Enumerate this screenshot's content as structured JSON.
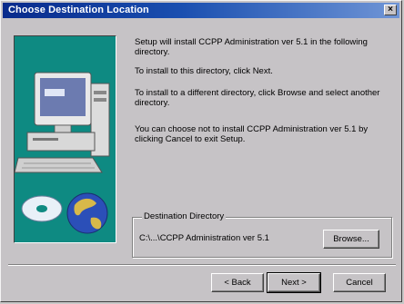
{
  "window": {
    "title": "Choose Destination Location"
  },
  "content": {
    "paragraph1": "Setup will install CCPP Administration ver 5.1 in the following directory.",
    "paragraph2": "To install to this directory, click Next.",
    "paragraph3": "To install to a different directory, click Browse and select another directory.",
    "paragraph4": "You can choose not to install CCPP Administration ver 5.1 by clicking Cancel to exit Setup."
  },
  "destination": {
    "group_label": "Destination Directory",
    "path": "C:\\...\\CCPP Administration ver 5.1",
    "browse_label": "Browse..."
  },
  "footer": {
    "back_label": "< Back",
    "next_label": "Next >",
    "cancel_label": "Cancel"
  },
  "icons": {
    "close": "close-icon",
    "artwork": "setup-computer-illustration"
  },
  "colors": {
    "title_start": "#082a8c",
    "title_end": "#6f95d6",
    "art_bg": "#0e8a82",
    "dialog_bg": "#c6c3c6"
  }
}
